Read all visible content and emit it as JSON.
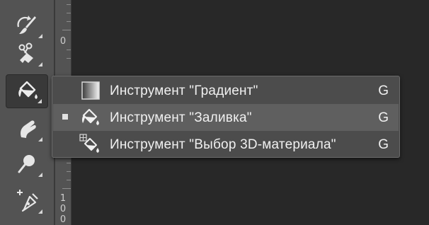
{
  "toolbar": {
    "tools": [
      {
        "name": "brush-tool",
        "icon": "history-brush-icon"
      },
      {
        "name": "eraser-tool",
        "icon": "background-eraser-icon"
      },
      {
        "name": "paint-bucket-tool",
        "icon": "paint-bucket-icon",
        "active": true
      },
      {
        "name": "smudge-tool",
        "icon": "smudge-icon"
      },
      {
        "name": "dodge-tool",
        "icon": "dodge-icon"
      },
      {
        "name": "pen-tool",
        "icon": "add-anchor-pen-icon"
      }
    ]
  },
  "ruler": {
    "labels": [
      "0",
      "1",
      "0",
      "0"
    ]
  },
  "flyout": {
    "items": [
      {
        "label": "Инструмент \"Градиент\"",
        "shortcut": "G",
        "icon": "gradient-icon",
        "selected": false
      },
      {
        "label": "Инструмент \"Заливка\"",
        "shortcut": "G",
        "icon": "paint-bucket-icon",
        "selected": true
      },
      {
        "label": "Инструмент \"Выбор 3D-материала\"",
        "shortcut": "G",
        "icon": "3d-material-drop-icon",
        "selected": false
      }
    ]
  },
  "colors": {
    "toolbar": "#535353",
    "canvas": "#282828",
    "menu": "#4c4c4c",
    "menu_selected": "#5f5f5f",
    "text": "#f0f0f0"
  }
}
